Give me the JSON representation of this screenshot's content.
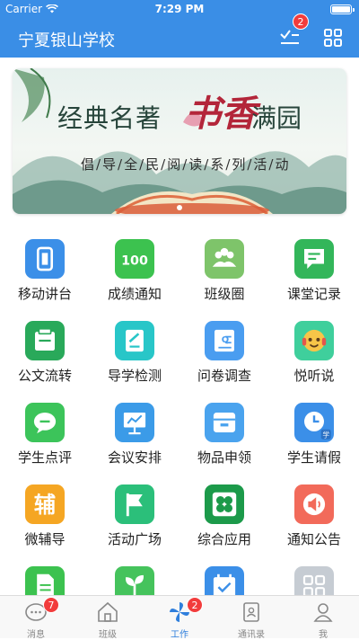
{
  "status": {
    "carrier": "Carrier",
    "time": "7:29 PM"
  },
  "nav": {
    "title": "宁夏银山学校",
    "todo_badge": "2"
  },
  "banner": {
    "headline_part1": "经典名著",
    "headline_accent": "书香",
    "headline_part2": "满园",
    "subline": "倡/导/全/民/阅/读/系/列/活/动"
  },
  "apps": [
    {
      "label": "移动讲台",
      "icon": "mobile-podium-icon",
      "color": "#3b8fe8"
    },
    {
      "label": "成绩通知",
      "icon": "score-notice-icon",
      "color": "#3cc24f"
    },
    {
      "label": "班级圈",
      "icon": "class-circle-icon",
      "color": "#7ec46a"
    },
    {
      "label": "课堂记录",
      "icon": "class-record-icon",
      "color": "#33b65a"
    },
    {
      "label": "公文流转",
      "icon": "document-flow-icon",
      "color": "#29a95a"
    },
    {
      "label": "导学检测",
      "icon": "study-check-icon",
      "color": "#28c6c8"
    },
    {
      "label": "问卷调查",
      "icon": "survey-icon",
      "color": "#4a9df0"
    },
    {
      "label": "悦听说",
      "icon": "listen-speak-icon",
      "color": "#3fcf9c"
    },
    {
      "label": "学生点评",
      "icon": "student-review-icon",
      "color": "#3cc45a"
    },
    {
      "label": "会议安排",
      "icon": "meeting-icon",
      "color": "#3b9be8"
    },
    {
      "label": "物品申领",
      "icon": "item-request-icon",
      "color": "#4aa3ee"
    },
    {
      "label": "学生请假",
      "icon": "student-leave-icon",
      "color": "#3b8fe8"
    },
    {
      "label": "微辅导",
      "icon": "micro-tutor-icon",
      "color": "#f5a623",
      "glyph": "辅"
    },
    {
      "label": "活动广场",
      "icon": "activity-square-icon",
      "color": "#2bbf7a"
    },
    {
      "label": "综合应用",
      "icon": "apps-icon",
      "color": "#1c9a4a"
    },
    {
      "label": "通知公告",
      "icon": "notice-icon",
      "color": "#f26a5a"
    },
    {
      "label": "",
      "icon": "file-icon",
      "color": "#3cc24f"
    },
    {
      "label": "",
      "icon": "sprout-icon",
      "color": "#45c35c"
    },
    {
      "label": "",
      "icon": "calendar-check-icon",
      "color": "#3b8fe8"
    },
    {
      "label": "",
      "icon": "more-apps-icon",
      "color": "#c6ccd3"
    }
  ],
  "tabs": [
    {
      "label": "消息",
      "badge": "7"
    },
    {
      "label": "班级",
      "badge": ""
    },
    {
      "label": "工作",
      "badge": "2"
    },
    {
      "label": "通讯录",
      "badge": ""
    },
    {
      "label": "我",
      "badge": ""
    }
  ],
  "colors": {
    "primary": "#3a8ee6",
    "badge": "#f23c3c",
    "active_tab": "#2f7fdc"
  }
}
